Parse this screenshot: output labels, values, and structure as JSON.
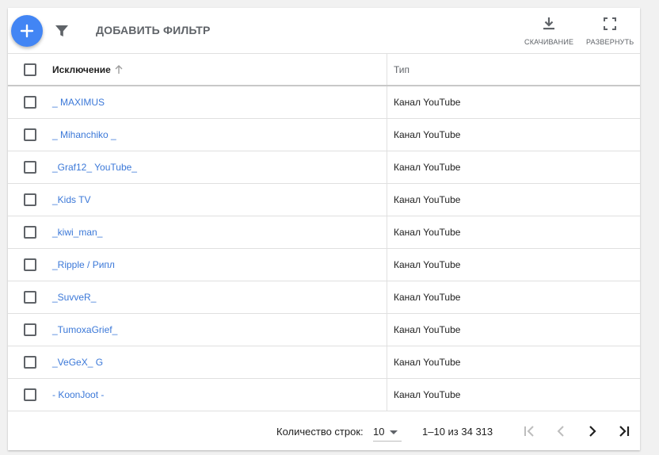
{
  "toolbar": {
    "add_filter_label": "ДОБАВИТЬ ФИЛЬТР",
    "download_label": "СКАЧИВАНИЕ",
    "expand_label": "РАЗВЕРНУТЬ"
  },
  "table": {
    "columns": [
      "Исключение",
      "Тип"
    ],
    "rows": [
      {
        "name": "_ MAXIMUS",
        "type": "Канал YouTube"
      },
      {
        "name": "_ Mihanchiko _",
        "type": "Канал YouTube"
      },
      {
        "name": "_Graf12_ YouTube_",
        "type": "Канал YouTube"
      },
      {
        "name": "_Kids TV",
        "type": "Канал YouTube"
      },
      {
        "name": "_kiwi_man_",
        "type": "Канал YouTube"
      },
      {
        "name": "_Ripple / Рипл",
        "type": "Канал YouTube"
      },
      {
        "name": "_SuvveR_",
        "type": "Канал YouTube"
      },
      {
        "name": "_TumoxaGrief_",
        "type": "Канал YouTube"
      },
      {
        "name": "_VeGeX_ G",
        "type": "Канал YouTube"
      },
      {
        "name": "- KoonJoot -",
        "type": "Канал YouTube"
      }
    ]
  },
  "footer": {
    "rows_per_page_label": "Количество строк:",
    "rows_per_page_value": "10",
    "range_text": "1–10 из 34 313"
  },
  "colors": {
    "accent": "#4285f4",
    "link": "#3b78d8"
  }
}
